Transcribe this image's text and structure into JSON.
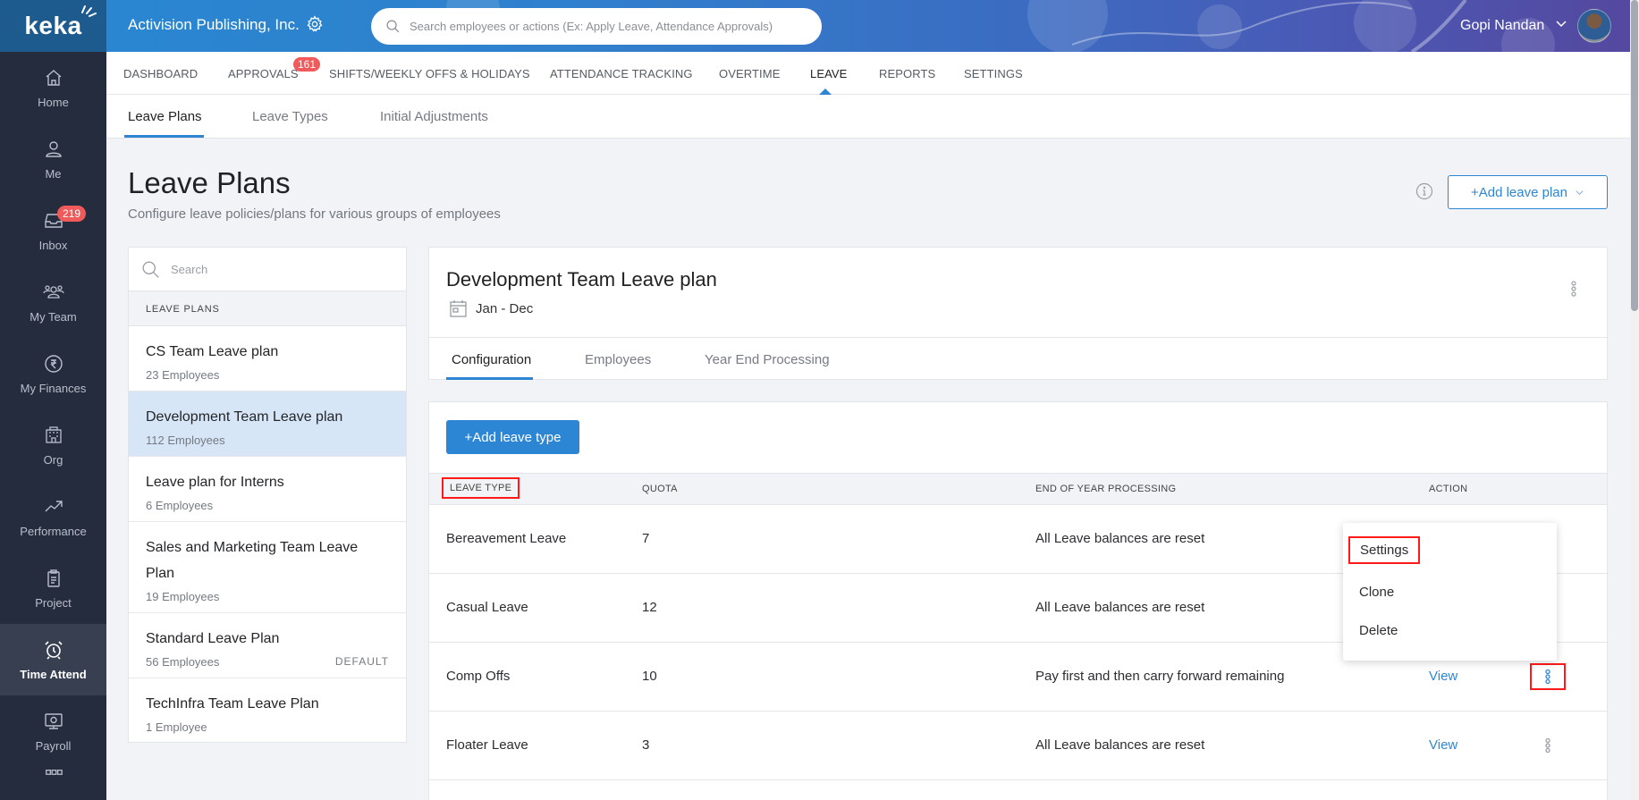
{
  "sidebar": {
    "logo": "keka",
    "items": [
      {
        "label": "Home",
        "icon": "home-icon"
      },
      {
        "label": "Me",
        "icon": "user-icon"
      },
      {
        "label": "Inbox",
        "icon": "inbox-icon",
        "badge": "219"
      },
      {
        "label": "My Team",
        "icon": "team-icon"
      },
      {
        "label": "My Finances",
        "icon": "rupee-icon"
      },
      {
        "label": "Org",
        "icon": "building-icon"
      },
      {
        "label": "Performance",
        "icon": "trend-icon"
      },
      {
        "label": "Project",
        "icon": "clipboard-icon"
      },
      {
        "label": "Time Attend",
        "icon": "alarm-clock-icon",
        "active": true
      },
      {
        "label": "Payroll",
        "icon": "payroll-monitor-icon"
      }
    ]
  },
  "header": {
    "company": "Activision Publishing, Inc.",
    "search_placeholder": "Search employees or actions (Ex: Apply Leave, Attendance Approvals)",
    "user_name": "Gopi Nandan"
  },
  "nav": {
    "items": [
      {
        "label": "DASHBOARD"
      },
      {
        "label": "APPROVALS",
        "badge": "161"
      },
      {
        "label": "SHIFTS/WEEKLY OFFS & HOLIDAYS"
      },
      {
        "label": "ATTENDANCE TRACKING"
      },
      {
        "label": "OVERTIME"
      },
      {
        "label": "LEAVE",
        "active": true
      },
      {
        "label": "REPORTS"
      },
      {
        "label": "SETTINGS"
      }
    ]
  },
  "subtabs": [
    {
      "label": "Leave Plans",
      "active": true
    },
    {
      "label": "Leave Types"
    },
    {
      "label": "Initial Adjustments"
    }
  ],
  "page": {
    "title": "Leave Plans",
    "subtitle": "Configure leave policies/plans for various groups of employees",
    "add_plan_label": "+Add leave plan"
  },
  "plans": {
    "search_placeholder": "Search",
    "heading": "LEAVE PLANS",
    "items": [
      {
        "name": "CS Team Leave plan",
        "count": "23 Employees"
      },
      {
        "name": "Development Team Leave plan",
        "count": "112 Employees",
        "active": true
      },
      {
        "name": "Leave plan for Interns",
        "count": "6 Employees"
      },
      {
        "name": "Sales and Marketing Team Leave Plan",
        "count": "19 Employees"
      },
      {
        "name": "Standard Leave Plan",
        "count": "56 Employees",
        "tag": "DEFAULT"
      },
      {
        "name": "TechInfra Team Leave Plan",
        "count": "1 Employee"
      }
    ]
  },
  "detail": {
    "title": "Development Team Leave plan",
    "period": "Jan - Dec",
    "tabs": [
      {
        "label": "Configuration",
        "active": true
      },
      {
        "label": "Employees"
      },
      {
        "label": "Year End Processing"
      }
    ],
    "add_type_label": "+Add leave type",
    "columns": [
      "LEAVE TYPE",
      "QUOTA",
      "END OF YEAR PROCESSING",
      "ACTION"
    ],
    "rows": [
      {
        "type": "Bereavement Leave",
        "quota": "7",
        "eoy": "All Leave balances are reset",
        "action": ""
      },
      {
        "type": "Casual Leave",
        "quota": "12",
        "eoy": "All Leave balances are reset",
        "action": ""
      },
      {
        "type": "Comp Offs",
        "quota": "10",
        "eoy": "Pay first and then carry forward remaining",
        "action": "View"
      },
      {
        "type": "Floater Leave",
        "quota": "3",
        "eoy": "All Leave balances are reset",
        "action": "View"
      }
    ],
    "menu": [
      "Settings",
      "Clone",
      "Delete"
    ]
  },
  "colors": {
    "accent": "#2d86d4",
    "sidebar": "#252c3d",
    "badge": "#f05a5b",
    "highlight": "#ff1a1a"
  }
}
